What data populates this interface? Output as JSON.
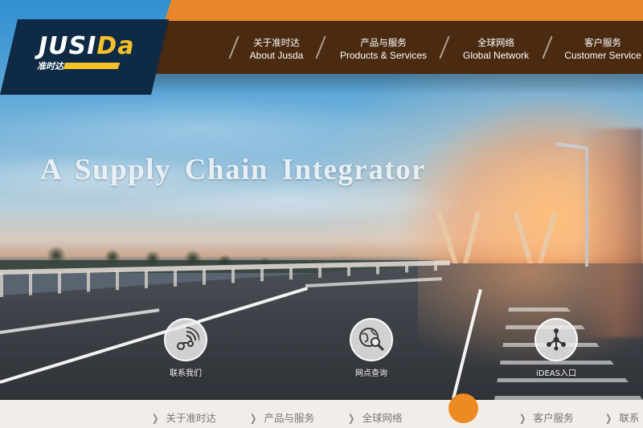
{
  "brand": {
    "logo_text_main": "JUSI",
    "logo_text_accent": "Da",
    "logo_cn": "准时达",
    "accent_color": "#f5c02a",
    "orange": "#e7862a",
    "navy": "#0f2a44",
    "brown": "#4a2a10"
  },
  "nav": {
    "items": [
      {
        "cn": "关于准时达",
        "en": "About Jusda"
      },
      {
        "cn": "产品与服务",
        "en": "Products & Services"
      },
      {
        "cn": "全球网络",
        "en": "Global Network"
      },
      {
        "cn": "客户服务",
        "en": "Customer Service"
      }
    ]
  },
  "hero": {
    "title": "A  Supply Chain Integrator"
  },
  "actions": [
    {
      "label": "联系我们",
      "icon": "contact-signal-icon"
    },
    {
      "label": "网点查询",
      "icon": "globe-search-icon"
    },
    {
      "label": "iDEAS入口",
      "icon": "network-nodes-icon"
    }
  ],
  "bottom_nav": {
    "items": [
      "关于准时达",
      "产品与服务",
      "全球网络",
      "客户服务",
      "联系"
    ]
  }
}
